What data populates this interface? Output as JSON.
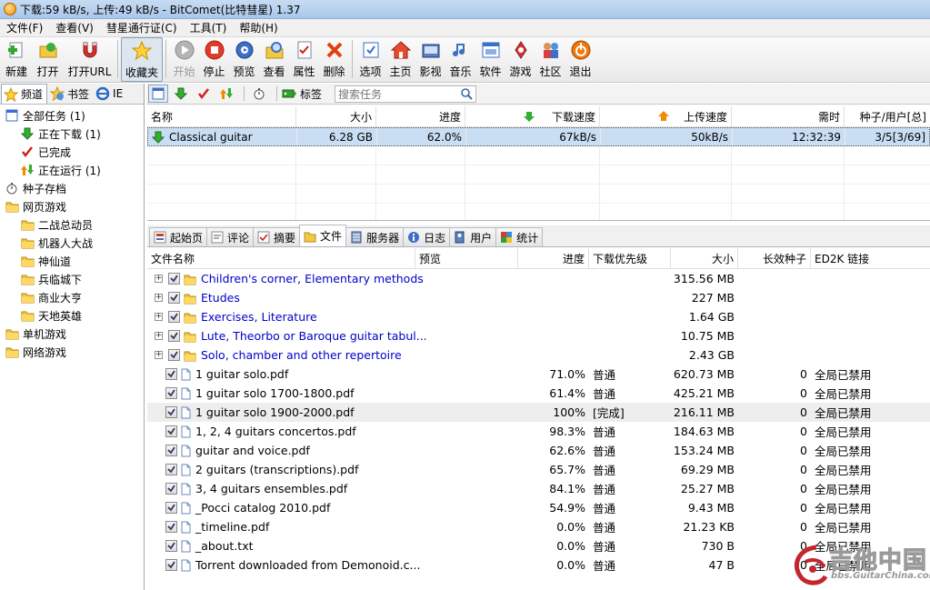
{
  "window": {
    "title": "下载:59 kB/s, 上传:49 kB/s - BitComet(比特彗星) 1.37"
  },
  "menu": [
    "文件(F)",
    "查看(V)",
    "彗星通行证(C)",
    "工具(T)",
    "帮助(H)"
  ],
  "toolbar": {
    "buttons": [
      {
        "label": "新建",
        "icon": "new-icon"
      },
      {
        "label": "打开",
        "icon": "open-icon"
      },
      {
        "label": "打开URL",
        "icon": "open-url-icon"
      },
      {
        "label": "收藏夹",
        "icon": "favorites-star-icon"
      },
      {
        "label": "开始",
        "icon": "start-icon"
      },
      {
        "label": "停止",
        "icon": "stop-icon"
      },
      {
        "label": "预览",
        "icon": "preview-icon"
      },
      {
        "label": "查看",
        "icon": "view-icon"
      },
      {
        "label": "属性",
        "icon": "properties-icon"
      },
      {
        "label": "删除",
        "icon": "delete-icon"
      },
      {
        "label": "选项",
        "icon": "options-icon"
      },
      {
        "label": "主页",
        "icon": "home-icon"
      },
      {
        "label": "影视",
        "icon": "movies-icon"
      },
      {
        "label": "音乐",
        "icon": "music-icon"
      },
      {
        "label": "软件",
        "icon": "software-icon"
      },
      {
        "label": "游戏",
        "icon": "games-icon"
      },
      {
        "label": "社区",
        "icon": "community-icon"
      },
      {
        "label": "退出",
        "icon": "exit-icon"
      }
    ]
  },
  "left_panel": {
    "tabs": [
      "频道",
      "书签",
      "IE"
    ],
    "tree": [
      {
        "label": "全部任务 (1)",
        "indent": 0,
        "icon": "all-tasks-icon"
      },
      {
        "label": "正在下载 (1)",
        "indent": 1,
        "icon": "downloading-arrow-icon"
      },
      {
        "label": "已完成",
        "indent": 1,
        "icon": "completed-check-icon"
      },
      {
        "label": "正在运行 (1)",
        "indent": 1,
        "icon": "running-arrows-icon"
      },
      {
        "label": "种子存档",
        "indent": 0,
        "icon": "torrent-archive-icon"
      },
      {
        "label": "网页游戏",
        "indent": 0,
        "icon": "folder-icon"
      },
      {
        "label": "二战总动员",
        "indent": 1,
        "icon": "folder-icon"
      },
      {
        "label": "机器人大战",
        "indent": 1,
        "icon": "folder-icon"
      },
      {
        "label": "神仙道",
        "indent": 1,
        "icon": "folder-icon"
      },
      {
        "label": "兵临城下",
        "indent": 1,
        "icon": "folder-icon"
      },
      {
        "label": "商业大亨",
        "indent": 1,
        "icon": "folder-icon"
      },
      {
        "label": "天地英雄",
        "indent": 1,
        "icon": "folder-icon"
      },
      {
        "label": "单机游戏",
        "indent": 0,
        "icon": "folder-icon"
      },
      {
        "label": "网络游戏",
        "indent": 0,
        "icon": "folder-icon"
      }
    ]
  },
  "task_toolbar": {
    "tag_label": "标签",
    "search_placeholder": "搜索任务"
  },
  "task_table": {
    "columns": [
      "名称",
      "大小",
      "进度",
      "下载速度",
      "上传速度",
      "需时",
      "种子/用户[总]"
    ],
    "rows": [
      {
        "name": "Classical guitar",
        "size": "6.28 GB",
        "progress": "62.0%",
        "down": "67kB/s",
        "up": "50kB/s",
        "eta": "12:32:39",
        "peers": "3/5[3/69]"
      }
    ]
  },
  "bottom_tabs": [
    {
      "label": "起始页",
      "icon": "start-page-icon"
    },
    {
      "label": "评论",
      "icon": "comment-icon"
    },
    {
      "label": "摘要",
      "icon": "summary-icon"
    },
    {
      "label": "文件",
      "icon": "files-folder-icon"
    },
    {
      "label": "服务器",
      "icon": "server-icon"
    },
    {
      "label": "日志",
      "icon": "log-info-icon"
    },
    {
      "label": "用户",
      "icon": "users-icon"
    },
    {
      "label": "统计",
      "icon": "statistics-icon"
    }
  ],
  "file_table": {
    "columns": [
      "文件名称",
      "预览",
      "进度",
      "下载优先级",
      "大小",
      "长效种子",
      "ED2K 链接"
    ],
    "folders": [
      {
        "name": "Children's corner, Elementary methods",
        "size": "315.56 MB"
      },
      {
        "name": "Etudes",
        "size": "227 MB"
      },
      {
        "name": "Exercises, Literature",
        "size": "1.64 GB"
      },
      {
        "name": "Lute, Theorbo or Baroque guitar tabul...",
        "size": "10.75 MB"
      },
      {
        "name": "Solo, chamber and other repertoire",
        "size": "2.43 GB"
      }
    ],
    "files": [
      {
        "name": "1 guitar solo.pdf",
        "progress": "71.0%",
        "priority": "普通",
        "size": "620.73 MB",
        "seeds": "0",
        "ed2k": "全局已禁用"
      },
      {
        "name": "1 guitar solo 1700-1800.pdf",
        "progress": "61.4%",
        "priority": "普通",
        "size": "425.21 MB",
        "seeds": "0",
        "ed2k": "全局已禁用"
      },
      {
        "name": "1 guitar solo 1900-2000.pdf",
        "progress": "100%",
        "priority": "[完成]",
        "size": "216.11 MB",
        "seeds": "0",
        "ed2k": "全局已禁用"
      },
      {
        "name": "1, 2, 4 guitars concertos.pdf",
        "progress": "98.3%",
        "priority": "普通",
        "size": "184.63 MB",
        "seeds": "0",
        "ed2k": "全局已禁用"
      },
      {
        "name": "guitar and voice.pdf",
        "progress": "62.6%",
        "priority": "普通",
        "size": "153.24 MB",
        "seeds": "0",
        "ed2k": "全局已禁用"
      },
      {
        "name": "2 guitars (transcriptions).pdf",
        "progress": "65.7%",
        "priority": "普通",
        "size": "69.29 MB",
        "seeds": "0",
        "ed2k": "全局已禁用"
      },
      {
        "name": "3, 4 guitars ensembles.pdf",
        "progress": "84.1%",
        "priority": "普通",
        "size": "25.27 MB",
        "seeds": "0",
        "ed2k": "全局已禁用"
      },
      {
        "name": "_Pocci catalog 2010.pdf",
        "progress": "54.9%",
        "priority": "普通",
        "size": "9.43 MB",
        "seeds": "0",
        "ed2k": "全局已禁用"
      },
      {
        "name": "_timeline.pdf",
        "progress": "0.0%",
        "priority": "普通",
        "size": "21.23 KB",
        "seeds": "0",
        "ed2k": "全局已禁用"
      },
      {
        "name": "_about.txt",
        "progress": "0.0%",
        "priority": "普通",
        "size": "730 B",
        "seeds": "0",
        "ed2k": "全局已禁用"
      },
      {
        "name": "Torrent downloaded from Demonoid.c...",
        "progress": "0.0%",
        "priority": "普通",
        "size": "47 B",
        "seeds": "0",
        "ed2k": "全局已禁用"
      }
    ]
  },
  "watermark": {
    "main": "吉他中国",
    "sub": "bbs.GuitarChina.com"
  }
}
